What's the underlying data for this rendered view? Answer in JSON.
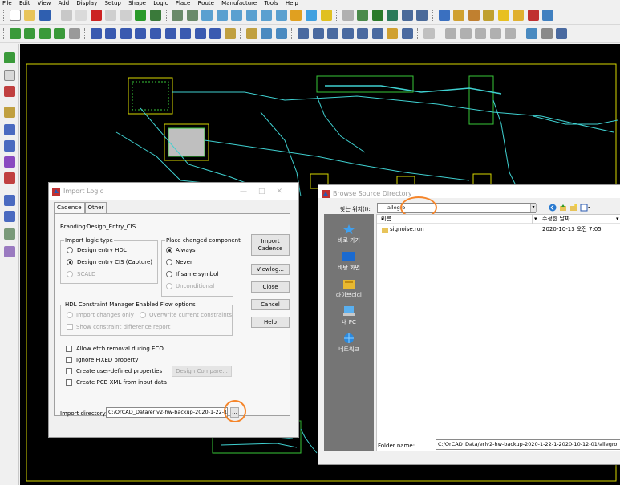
{
  "menu": [
    "File",
    "Edit",
    "View",
    "Add",
    "Display",
    "Setup",
    "Shape",
    "Logic",
    "Place",
    "Route",
    "Manufacture",
    "Tools",
    "Help"
  ],
  "import_logic": {
    "title": "Import Logic",
    "tabs": [
      "Cadence",
      "Other"
    ],
    "branding_label": "Branding:",
    "branding_value": "Design_Entry_CIS",
    "logic_type": {
      "legend": "Import logic type",
      "options": [
        "Design entry HDL",
        "Design entry CIS (Capture)",
        "SCALD"
      ],
      "selected": "Design entry CIS (Capture)"
    },
    "place_changed": {
      "legend": "Place changed component",
      "options": [
        "Always",
        "Never",
        "If same symbol",
        "Unconditional"
      ],
      "selected": "Always"
    },
    "hdl": {
      "legend": "HDL Constraint Manager Enabled Flow options",
      "options": [
        "Import changes only",
        "Overwrite current constraints"
      ],
      "show_diff": "Show constraint difference report"
    },
    "checkboxes": [
      "Allow etch removal during ECO",
      "Ignore FIXED property",
      "Create user-defined properties",
      "Create PCB XML from input data"
    ],
    "design_compare": "Design Compare...",
    "import_dir_label": "Import directory:",
    "import_dir_value": "C:/OrCAD_Data/erlv2-hw-backup-2020-1-22-1",
    "browse_button": "...",
    "buttons": {
      "import_cadence": "Import Cadence",
      "viewlog": "Viewlog...",
      "close": "Close",
      "cancel": "Cancel",
      "help": "Help"
    }
  },
  "browse": {
    "title": "Browse Source Directory",
    "lookin_label": "찾는 위치(I):",
    "lookin_value": "allegro",
    "places": [
      "바로 가기",
      "바탕 화면",
      "라이브러리",
      "내 PC",
      "네트워크"
    ],
    "columns": [
      "이름",
      "수정한 날짜"
    ],
    "files": [
      {
        "name": "signoise.run",
        "date": "2020-10-13 오전 7:05"
      }
    ],
    "folder_label": "Folder name:",
    "folder_value": "C:/OrCAD_Data/erlv2-hw-backup-2020-1-22-1-2020-10-12-01/allegro"
  },
  "colors": {
    "accent": "#f5852a",
    "canvas": "#000000",
    "trace": "#3fd0d0",
    "outline": "#d8d800",
    "pad": "#38c838",
    "places_panel": "#757575"
  }
}
